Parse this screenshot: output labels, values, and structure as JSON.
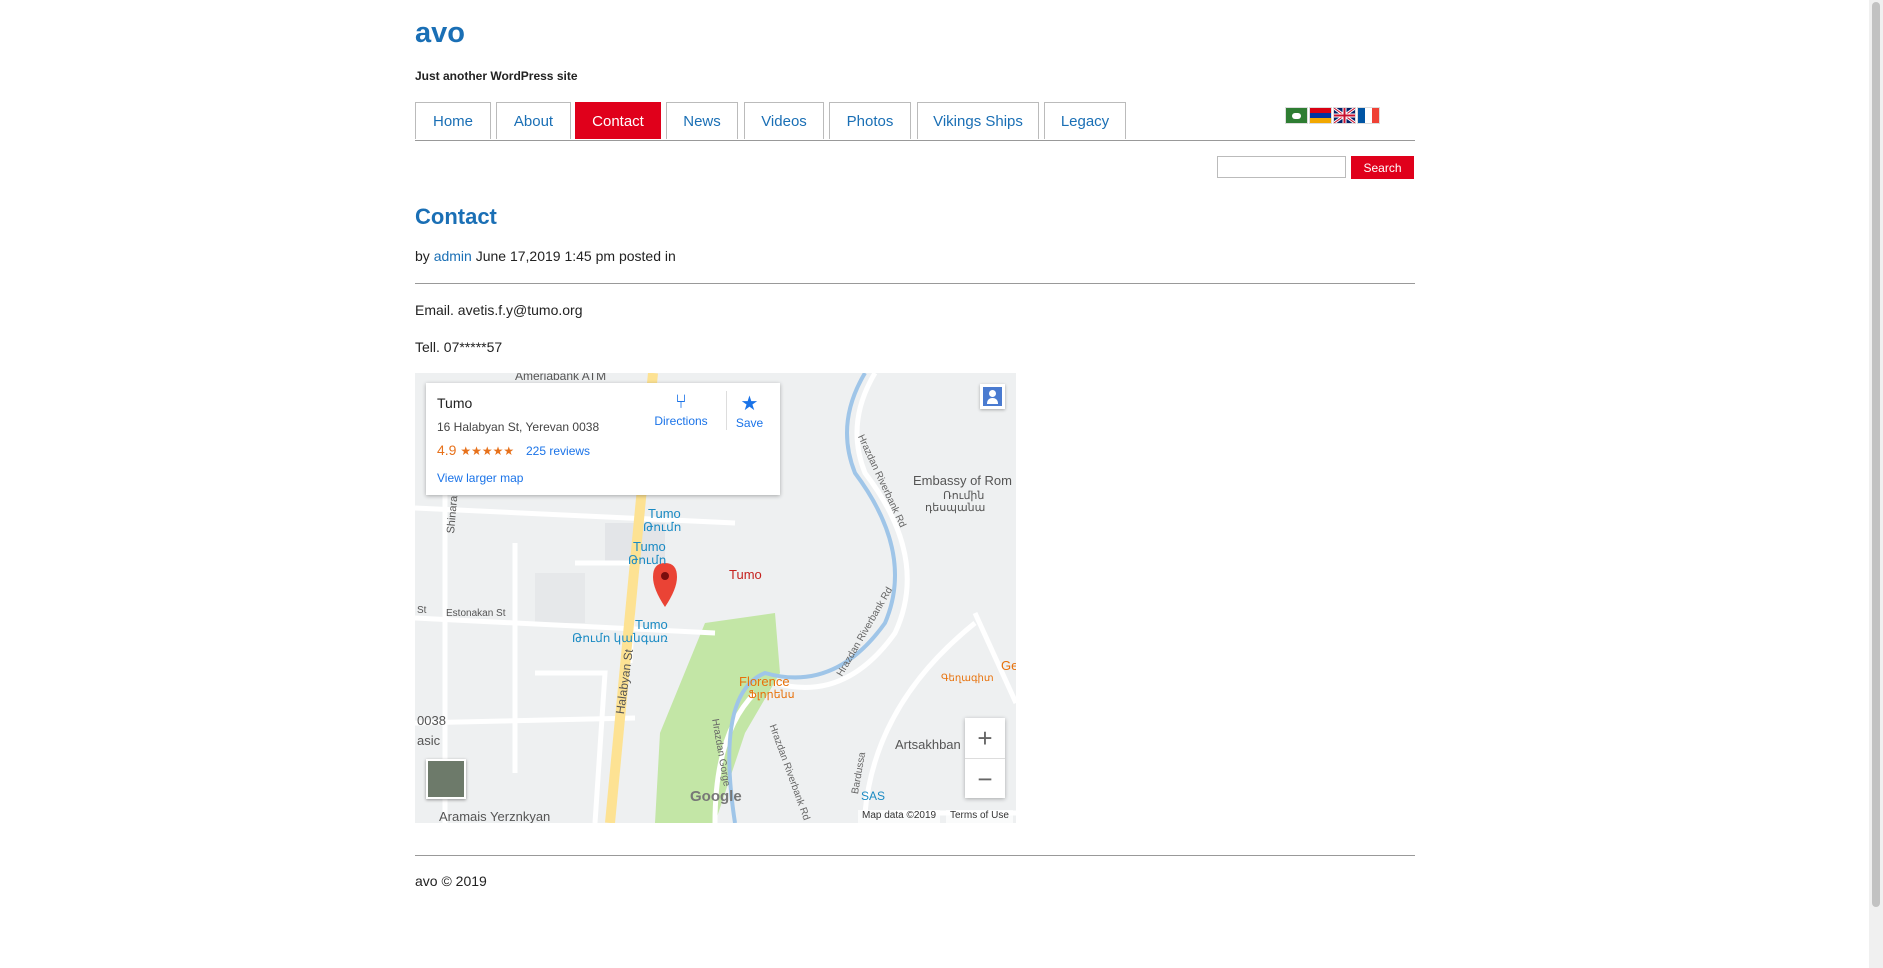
{
  "site": {
    "title": "avo",
    "tagline": "Just another WordPress site"
  },
  "nav": {
    "tabs": [
      {
        "label": "Home"
      },
      {
        "label": "About"
      },
      {
        "label": "Contact"
      },
      {
        "label": "News"
      },
      {
        "label": "Videos"
      },
      {
        "label": "Photos"
      },
      {
        "label": "Vikings Ships"
      },
      {
        "label": "Legacy"
      }
    ],
    "active": "Contact"
  },
  "search": {
    "button_label": "Search",
    "placeholder": ""
  },
  "post": {
    "title": "Contact",
    "meta_by": "by",
    "author": "admin",
    "datetime": "June 17,2019 1:45 pm",
    "posted_in": "posted in",
    "email_line": "Email. avetis.f.y@tumo.org",
    "tell_line": "Tell. 07*****57"
  },
  "map": {
    "card": {
      "name": "Tumo",
      "address": "16 Halabyan St, Yerevan 0038",
      "rating": "4.9",
      "stars": "★★★★★",
      "reviews": "225 reviews",
      "view_larger": "View larger map",
      "directions": "Directions",
      "save": "Save"
    },
    "labels": {
      "ameriabank": "Ameriabank ATM",
      "embassy1": "Embassy of Rom",
      "embassy2": "Ռումին",
      "embassy3": "դեսպանա",
      "tumo1": "Tumo",
      "tumo1b": "Թումո",
      "tumo2": "Tumo",
      "tumo2b": "Թումո",
      "tumo_pin": "Tumo",
      "tumo3": "Tumo",
      "tumo3b": "Թումո կանգառ",
      "florence": "Florence",
      "florence_b": "Ֆլորենս",
      "artsakhban": "Artsakhban",
      "sas": "SAS",
      "aramais": "Aramais Yerznkyan",
      "estonakan": "Estonakan St",
      "st": "St",
      "halabyan": "Halabyan St",
      "hrazdan_rb": "Hrazdan Riverbank Rd",
      "hrazdan_rb2": "Hrazdan Riverbank Rd",
      "hrazdan_rb3": "Hrazdan Riverbank Rd",
      "hrazdan_gorge": "Hrazdan Gorge",
      "bagratunyats": "Bardussa",
      "zip": "0038",
      "asic": "asic",
      "shinarar": "Shinara",
      "ge": "Ge",
      "ge2": "Գեղագիտ",
      "google": "Google"
    },
    "attribution": {
      "data": "Map data ©2019",
      "terms": "Terms of Use"
    },
    "zoom_in": "+",
    "zoom_out": "−"
  },
  "footer": {
    "text": "avo © 2019"
  },
  "colors": {
    "link": "#1a6fb5",
    "accent": "#e0001b",
    "pin": "#ea4335",
    "park": "#c3e6a6",
    "road_major": "#fde293",
    "river": "#9fc5e8"
  }
}
